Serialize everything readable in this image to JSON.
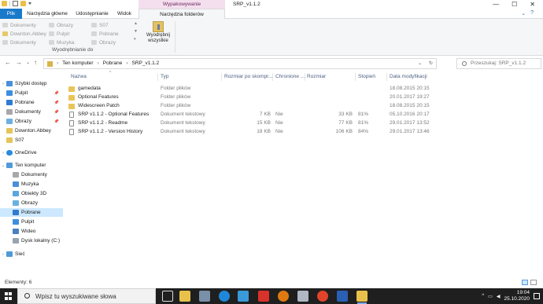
{
  "title_bar": {
    "window_title": "SRP_v1.1.2",
    "context_tab_header": "Wypakowywanie",
    "min": "—",
    "max": "☐",
    "close": "✕"
  },
  "ribbon_tabs": {
    "file": "Plik",
    "home": "Narzędzia główne",
    "share": "Udostępnianie",
    "view": "Widok",
    "compressed_tools": "Narzędzia folderów skompresowanych"
  },
  "ribbon": {
    "targets_col1": [
      "Dokumenty",
      "Downton.Abbey",
      "Dokumenty"
    ],
    "targets_col2": [
      "Obrazy",
      "Pulpit",
      "Muzyka"
    ],
    "targets_col3": [
      "S07",
      "Pobrane",
      "Obrazy"
    ],
    "extract_all_line1": "Wyodrębnij",
    "extract_all_line2": "wszystkie",
    "group_label": "Wyodrębnianie do"
  },
  "address": {
    "crumbs": [
      "Ten komputer",
      "Pobrane",
      "SRP_v1.1.2"
    ],
    "search_placeholder": "Przeszukaj: SRP_v1.1.2"
  },
  "sidebar": {
    "quick_access": "Szybki dostęp",
    "quick_items": [
      "Pulpit",
      "Pobrane",
      "Dokumenty",
      "Obrazy",
      "Downton.Abbey",
      "S07"
    ],
    "onedrive": "OneDrive",
    "this_pc": "Ten komputer",
    "pc_items": [
      "Dokumenty",
      "Muzyka",
      "Obiekty 3D",
      "Obrazy",
      "Pobrane",
      "Pulpit",
      "Wideo",
      "Dysk lokalny (C:)"
    ],
    "network": "Sieć"
  },
  "columns": {
    "name": "Nazwa",
    "type": "Typ",
    "packed_size": "Rozmiar po skompr...",
    "protected": "Chronione ...",
    "size": "Rozmiar",
    "ratio": "Stopień",
    "modified": "Data modyfikacji"
  },
  "files": [
    {
      "name": "gamedata",
      "kind": "folder",
      "type": "Folder plików",
      "packed": "",
      "protected": "",
      "size": "",
      "ratio": "",
      "modified": "18.08.2015 20:15"
    },
    {
      "name": "Optional Features",
      "kind": "folder",
      "type": "Folder plików",
      "packed": "",
      "protected": "",
      "size": "",
      "ratio": "",
      "modified": "20.01.2017 19:27"
    },
    {
      "name": "Widescreen Patch",
      "kind": "folder",
      "type": "Folder plików",
      "packed": "",
      "protected": "",
      "size": "",
      "ratio": "",
      "modified": "18.08.2015 20:15"
    },
    {
      "name": "SRP v1.1.2 - Optional Features",
      "kind": "doc",
      "type": "Dokument tekstowy",
      "packed": "7 KB",
      "protected": "Nie",
      "size": "33 KB",
      "ratio": "81%",
      "modified": "05.10.2016 20:17"
    },
    {
      "name": "SRP v1.1.2 - Readme",
      "kind": "doc",
      "type": "Dokument tekstowy",
      "packed": "15 KB",
      "protected": "Nie",
      "size": "77 KB",
      "ratio": "81%",
      "modified": "29.01.2017 13:52"
    },
    {
      "name": "SRP v1.1.2 - Version History",
      "kind": "doc",
      "type": "Dokument tekstowy",
      "packed": "18 KB",
      "protected": "Nie",
      "size": "106 KB",
      "ratio": "84%",
      "modified": "29.01.2017 13:46"
    }
  ],
  "status": {
    "items_count": "Elementy: 6"
  },
  "taskbar": {
    "search_placeholder": "Wpisz tu wyszukiwane słowa",
    "time": "19:04",
    "date": "25.10.2020",
    "tray_chevron": "^"
  }
}
